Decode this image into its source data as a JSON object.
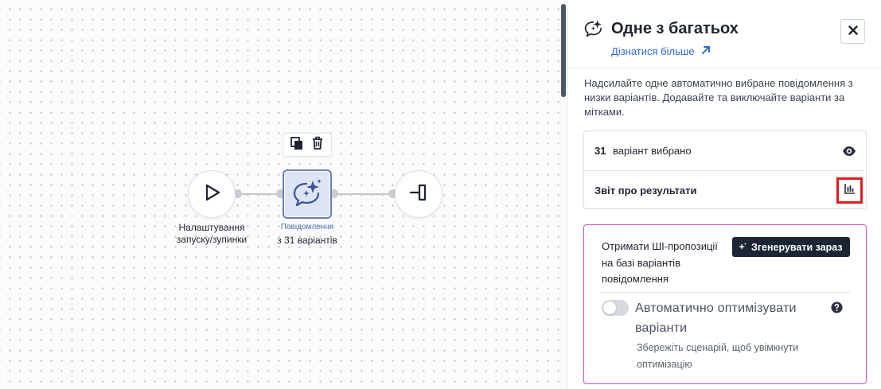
{
  "canvas": {
    "nodes": {
      "start": {
        "label_line1": "Налаштування",
        "label_line2": "запуску/зупинки",
        "icon": "play-icon"
      },
      "message": {
        "sublabel": "Повідомлення",
        "label": "з 31 варіантів",
        "icon": "sparkle-chat-icon"
      },
      "end": {
        "icon": "exit-icon"
      }
    },
    "toolbar": {
      "copy_icon": "copy-icon",
      "delete_icon": "trash-icon"
    }
  },
  "panel": {
    "title": "Одне з багатьох",
    "learn_more": "Дізнатися більше",
    "description": "Надсилайте одне автоматично вибране повідомлення з низки варіантів. Додавайте та виключайте варіанти за мітками.",
    "variants": {
      "count": "31",
      "label": "варіант вибрано"
    },
    "report": {
      "label": "Звіт про результати"
    },
    "ai": {
      "text": "Отримати ШІ-пропозиції на базі варіантів повідомлення",
      "generate_button": "Згенерувати зараз",
      "optimize_label": "Автоматично оптимізувати варіанти",
      "optimize_enabled": false,
      "optimize_hint": "Збережіть сценарій, щоб увімкнути оптимізацію"
    }
  },
  "colors": {
    "accent_link": "#2f6bd1",
    "highlight": "#e31b1b",
    "ai_border": "#c94fc1",
    "dark_button": "#1d2433"
  }
}
